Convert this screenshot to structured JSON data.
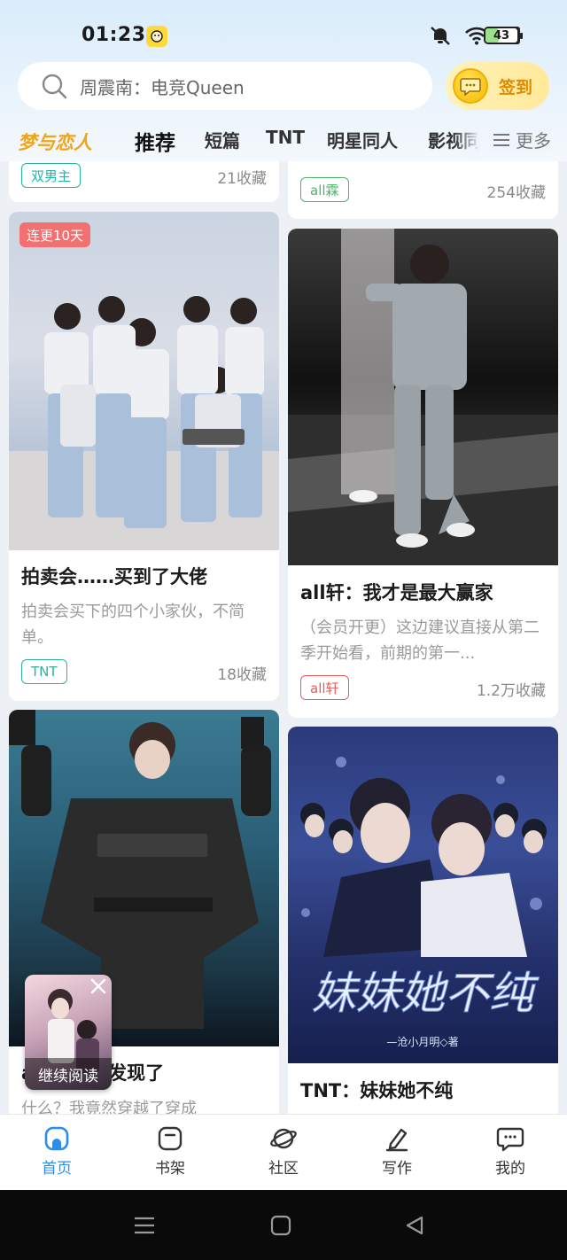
{
  "status": {
    "time": "01:23",
    "battery": "43",
    "battery_level": 0.43
  },
  "search": {
    "text": "周震南：电竞Queen"
  },
  "signin": {
    "label": "签到"
  },
  "tabs": [
    {
      "label": "梦与恋人"
    },
    {
      "label": "推荐"
    },
    {
      "label": "短篇"
    },
    {
      "label": "TNT"
    },
    {
      "label": "明星同人"
    },
    {
      "label": "影视同"
    }
  ],
  "more": {
    "label": "更多"
  },
  "feed": {
    "top_left": {
      "tag": "双男主",
      "favorites": "21收藏"
    },
    "top_right": {
      "tag": "all霖",
      "favorites": "254收藏"
    },
    "card1": {
      "badge": "连更10天",
      "title": "拍卖会……买到了大佬",
      "desc": "拍卖会买下的四个小家伙，不简单。",
      "tag": "TNT",
      "favorites": "18收藏"
    },
    "card2": {
      "title": "all轩：我才是最大赢家",
      "desc": "（会员开更）这边建议直接从第二季开始看，前期的第一...",
      "tag": "all轩",
      "favorites": "1.2万收藏"
    },
    "card3": {
      "title": "a：我！被发现了",
      "desc": "什么？我竟然穿越了穿成"
    },
    "card4": {
      "title": "TNT：妹妹她不纯",
      "cover_title": "妹妹她不纯",
      "cover_author": "—沧小月明◇著"
    }
  },
  "floating": {
    "label": "继续阅读"
  },
  "nav": [
    {
      "label": "首页"
    },
    {
      "label": "书架"
    },
    {
      "label": "社区"
    },
    {
      "label": "写作"
    },
    {
      "label": "我的"
    }
  ],
  "colors": {
    "accent": "#2a8ef0",
    "brand": "#f0a418",
    "badge": "#f27070"
  }
}
